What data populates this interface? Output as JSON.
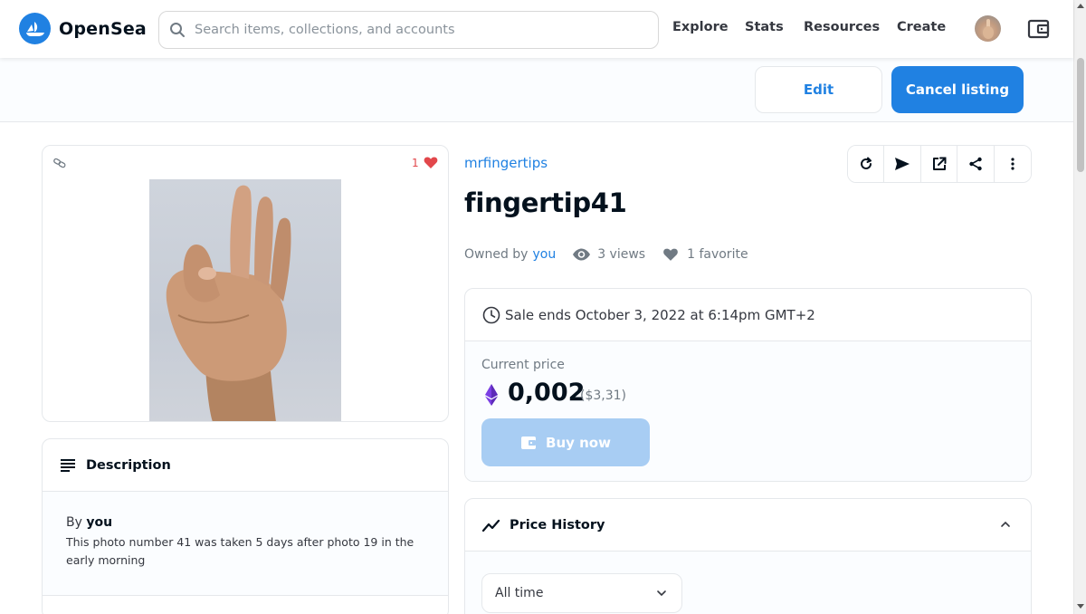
{
  "nav": {
    "brand": "OpenSea",
    "search_placeholder": "Search items, collections, and accounts",
    "links": [
      "Explore",
      "Stats",
      "Resources",
      "Create"
    ]
  },
  "owner_actions": {
    "edit_label": "Edit",
    "cancel_label": "Cancel listing"
  },
  "media": {
    "favorite_count": "1"
  },
  "description": {
    "title": "Description",
    "by_prefix": "By",
    "by_name": "you",
    "text": "This photo number 41 was taken 5 days after photo 19 in the early morning"
  },
  "item": {
    "collection": "mrfingertips",
    "name": "fingertip41",
    "owned_by_prefix": "Owned by",
    "owner": "you",
    "views": "3 views",
    "favorites": "1 favorite"
  },
  "sale": {
    "ends_text": "Sale ends October 3, 2022 at 6:14pm GMT+2",
    "price_label": "Current price",
    "price_eth": "0,002",
    "price_usd": "($3,31)",
    "buy_label": "Buy now"
  },
  "price_history": {
    "title": "Price History",
    "range_selected": "All time"
  },
  "colors": {
    "accent": "#2081e2",
    "heart": "#e2474b",
    "buy_disabled": "#a8cdf3"
  }
}
